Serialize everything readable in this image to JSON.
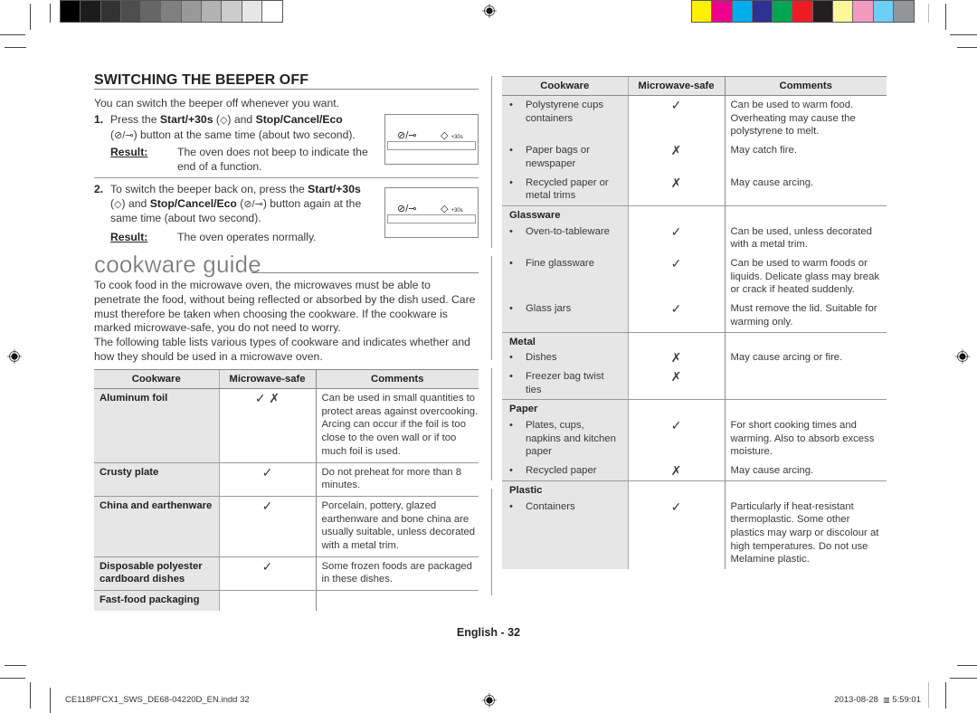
{
  "print_marks": {
    "gray_swatches": [
      "#000000",
      "#1c1c1c",
      "#333333",
      "#4d4d4d",
      "#666666",
      "#808080",
      "#999999",
      "#b3b3b3",
      "#cccccc",
      "#e6e6e6",
      "#ffffff"
    ],
    "color_swatches": [
      "#fff200",
      "#ec008c",
      "#00aeef",
      "#2e3192",
      "#00a651",
      "#ed1c24",
      "#231f20",
      "#fff799",
      "#f49ac1",
      "#6dcff6",
      "#939598"
    ]
  },
  "beeper": {
    "title": "SWITCHING THE BEEPER OFF",
    "intro": "You can switch the beeper off whenever you want.",
    "steps": [
      {
        "number": "1.",
        "parts": [
          "Press the ",
          "Start/+30s",
          " (",
          "start-icon",
          ") and ",
          "Stop/Cancel/Eco",
          " (",
          "stop-eco-icon",
          ") button at the same time (about two second)."
        ],
        "text_plain": "Press the Start/+30s (◇) and Stop/Cancel/Eco (⊘/eco) button at the same time (about two second).",
        "result_label": "Result:",
        "result_text": "The oven does not beep to indicate the end of a function."
      },
      {
        "number": "2.",
        "text_plain": "To switch the beeper back on, press the Start/+30s (◇) and Stop/Cancel/Eco (⊘/eco) button again at the same time (about two second).",
        "result_label": "Result:",
        "result_text": "The oven operates normally."
      }
    ],
    "panel": {
      "stop_symbol": "⊘/⊸",
      "start_symbol": "◇",
      "start_suffix": "+30s"
    },
    "bold_terms": {
      "start": "Start/+30s",
      "stop": "Stop/Cancel/Eco"
    },
    "text_fragments": {
      "s1_a": "Press the ",
      "s1_b": " (",
      "s1_c": ") and ",
      "s1_d": "(",
      "s1_e": ") button at the same time (about two second).",
      "s2_a": "To switch the beeper back on, press the ",
      "s2_b": "(",
      "s2_c": ") and ",
      "s2_d": " (",
      "s2_e": ") button again at the same time (about two second)."
    }
  },
  "guide": {
    "title": "cookware guide",
    "paragraph1": "To cook food in the microwave oven, the microwaves must be able to penetrate the food, without being reflected or absorbed by the dish used. Care must therefore be taken when choosing the cookware. If the cookware is marked microwave-safe, you do not need to worry.",
    "paragraph2": "The following table lists various types of cookware and indicates whether and how they should be used in a microwave oven."
  },
  "table_headers": {
    "cookware": "Cookware",
    "safe": "Microwave-safe",
    "comments": "Comments"
  },
  "left_table": [
    {
      "cookware": "Aluminum foil",
      "safe": "✓ ✗",
      "comments": "Can be used in small quantities to protect areas against overcooking. Arcing can occur if the foil is too close to the oven wall or if too much foil is used."
    },
    {
      "cookware": "Crusty plate",
      "safe": "✓",
      "comments": "Do not preheat for more than 8 minutes."
    },
    {
      "cookware": "China and earthenware",
      "safe": "✓",
      "comments": "Porcelain, pottery, glazed earthenware and bone china are usually suitable, unless decorated with a metal trim."
    },
    {
      "cookware": "Disposable polyester cardboard dishes",
      "safe": "✓",
      "comments": "Some frozen foods are packaged in these dishes."
    },
    {
      "cookware": "Fast-food packaging",
      "safe": "",
      "comments": ""
    }
  ],
  "right_table": {
    "groups": [
      {
        "category": "",
        "items": [
          {
            "cookware": "Polystyrene cups containers",
            "safe": "✓",
            "comments": "Can be used to warm food. Overheating may cause the polystyrene to melt."
          },
          {
            "cookware": "Paper bags or newspaper",
            "safe": "✗",
            "comments": "May catch fire."
          },
          {
            "cookware": "Recycled paper or metal trims",
            "safe": "✗",
            "comments": "May cause arcing."
          }
        ]
      },
      {
        "category": "Glassware",
        "items": [
          {
            "cookware": "Oven-to-tableware",
            "safe": "✓",
            "comments": "Can be used, unless decorated with a metal trim."
          },
          {
            "cookware": "Fine glassware",
            "safe": "✓",
            "comments": "Can be used to warm foods or liquids. Delicate glass may break or crack if heated suddenly."
          },
          {
            "cookware": "Glass jars",
            "safe": "✓",
            "comments": "Must remove the lid. Suitable for warming only."
          }
        ]
      },
      {
        "category": "Metal",
        "items": [
          {
            "cookware": "Dishes",
            "safe": "✗",
            "comments": "May cause arcing or fire."
          },
          {
            "cookware": "Freezer bag twist ties",
            "safe": "✗",
            "comments": ""
          }
        ]
      },
      {
        "category": "Paper",
        "items": [
          {
            "cookware": "Plates, cups, napkins and kitchen paper",
            "safe": "✓",
            "comments": "For short cooking times and warming. Also to absorb excess moisture."
          },
          {
            "cookware": "Recycled paper",
            "safe": "✗",
            "comments": "May cause arcing."
          }
        ]
      },
      {
        "category": "Plastic",
        "items": [
          {
            "cookware": "Containers",
            "safe": "✓",
            "comments": "Particularly if heat-resistant thermoplastic. Some other plastics may warp or discolour at high temperatures. Do not use Melamine plastic."
          }
        ]
      }
    ]
  },
  "footer": {
    "page_label": "English - 32",
    "file_name": "CE118PFCX1_SWS_DE68-04220D_EN.indd   32",
    "date": "2013-08-28",
    "time_glyph": "▥",
    "time": "5:59:01"
  }
}
